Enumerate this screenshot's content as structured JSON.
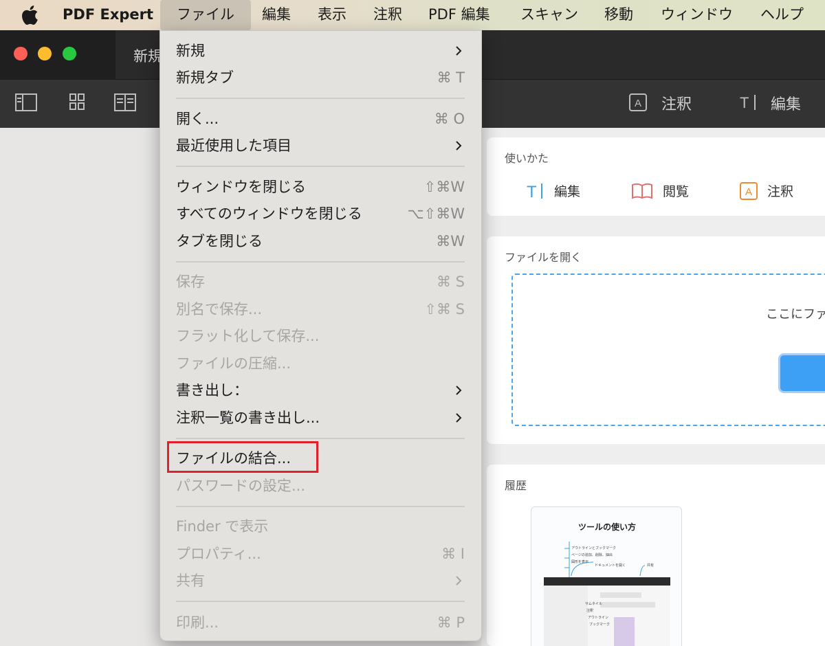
{
  "menubar": {
    "app_name": "PDF Expert",
    "items": [
      "ファイル",
      "編集",
      "表示",
      "注釈",
      "PDF 編集",
      "スキャン",
      "移動",
      "ウィンドウ",
      "ヘルプ"
    ]
  },
  "window": {
    "tab_title": "新規",
    "toolbar_annotate": "注釈",
    "toolbar_edit": "編集"
  },
  "usage": {
    "title": "使いかた",
    "edit": "編集",
    "read": "閲覧",
    "annotate": "注釈"
  },
  "open_file": {
    "title": "ファイルを開く",
    "drop_text": "ここにファ"
  },
  "history": {
    "title": "履歴",
    "thumb_title": "ツールの使い方",
    "thumb_lines": [
      "アウトラインとブックマーク",
      "ページの追加、削除、抽出",
      "図形を表示",
      "ドキュメントを開く",
      "共有",
      "サムネイル",
      "注釈",
      "アウトライン",
      "ブックマーク"
    ]
  },
  "file_menu": {
    "items": [
      {
        "label": "新規",
        "shortcut": "",
        "submenu": true,
        "enabled": true
      },
      {
        "label": "新規タブ",
        "shortcut": "⌘ T",
        "submenu": false,
        "enabled": true
      },
      {
        "label": "開く...",
        "shortcut": "⌘ O",
        "submenu": false,
        "enabled": true
      },
      {
        "label": "最近使用した項目",
        "shortcut": "",
        "submenu": true,
        "enabled": true
      },
      {
        "label": "ウィンドウを閉じる",
        "shortcut": "⇧⌘W",
        "submenu": false,
        "enabled": true
      },
      {
        "label": "すべてのウィンドウを閉じる",
        "shortcut": "⌥⇧⌘W",
        "submenu": false,
        "enabled": true
      },
      {
        "label": "タブを閉じる",
        "shortcut": "⌘W",
        "submenu": false,
        "enabled": true
      },
      {
        "label": "保存",
        "shortcut": "⌘ S",
        "submenu": false,
        "enabled": false
      },
      {
        "label": "別名で保存...",
        "shortcut": "⇧⌘ S",
        "submenu": false,
        "enabled": false
      },
      {
        "label": "フラット化して保存...",
        "shortcut": "",
        "submenu": false,
        "enabled": false
      },
      {
        "label": "ファイルの圧縮...",
        "shortcut": "",
        "submenu": false,
        "enabled": false
      },
      {
        "label": "書き出し：",
        "shortcut": "",
        "submenu": true,
        "enabled": true
      },
      {
        "label": "注釈一覧の書き出し...",
        "shortcut": "",
        "submenu": true,
        "enabled": true
      },
      {
        "label": "ファイルの結合...",
        "shortcut": "",
        "submenu": false,
        "enabled": true
      },
      {
        "label": "パスワードの設定...",
        "shortcut": "",
        "submenu": false,
        "enabled": false
      },
      {
        "label": "Finder で表示",
        "shortcut": "",
        "submenu": false,
        "enabled": false
      },
      {
        "label": "プロパティ...",
        "shortcut": "⌘ I",
        "submenu": false,
        "enabled": false
      },
      {
        "label": "共有",
        "shortcut": "",
        "submenu": true,
        "enabled": false
      },
      {
        "label": "印刷...",
        "shortcut": "⌘ P",
        "submenu": false,
        "enabled": false
      }
    ]
  },
  "colors": {
    "highlight_border": "#e0202a",
    "accent_blue": "#3da0f5",
    "traffic_red": "#fe5f57",
    "traffic_yellow": "#febc2e",
    "traffic_green": "#28c840"
  }
}
